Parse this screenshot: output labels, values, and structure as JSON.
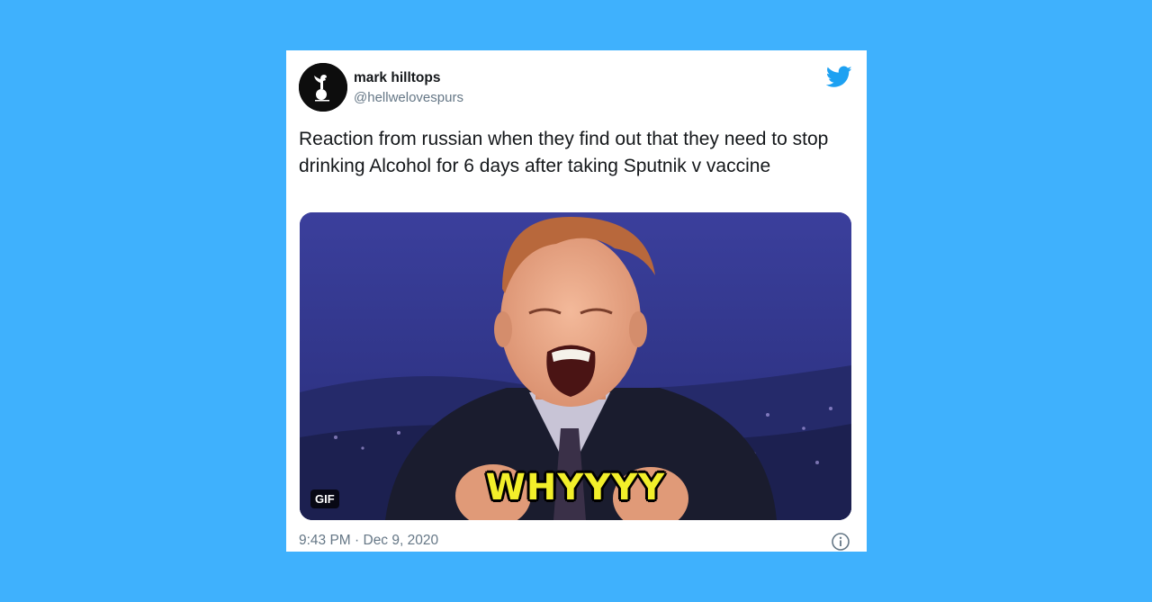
{
  "tweet": {
    "display_name": "mark hilltops",
    "handle": "@hellwelovespurs",
    "text": "Reaction from russian when they find out that they need to stop drinking Alcohol for 6 days after taking Sputnik v vaccine",
    "media": {
      "caption": "WHYYYY",
      "badge": "GIF"
    },
    "timestamp": "9:43 PM · Dec 9, 2020"
  },
  "icons": {
    "brand": "twitter-bird-icon",
    "info": "info-icon",
    "avatar": "cockerel-crest-logo"
  },
  "colors": {
    "background": "#3fb1fd",
    "twitter_blue": "#1da1f2",
    "secondary_text": "#657786",
    "primary_text": "#14171a",
    "caption": "#f2ef2a"
  }
}
